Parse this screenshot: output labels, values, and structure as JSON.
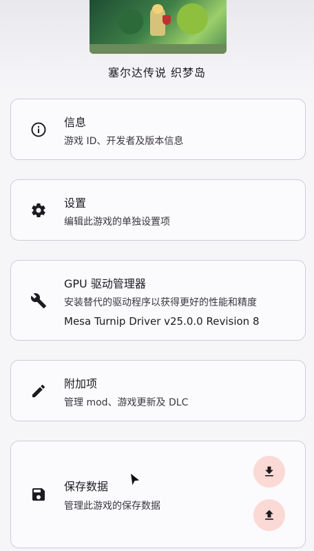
{
  "game": {
    "title": "塞尔达传说 织梦岛"
  },
  "cards": {
    "info": {
      "title": "信息",
      "subtitle": "游戏 ID、开发者及版本信息",
      "icon": "info-icon"
    },
    "settings": {
      "title": "设置",
      "subtitle": "编辑此游戏的单独设置项",
      "icon": "gear-icon"
    },
    "gpu": {
      "title": "GPU 驱动管理器",
      "subtitle": "安装替代的驱动程序以获得更好的性能和精度",
      "driver": "Mesa Turnip Driver v25.0.0 Revision 8",
      "icon": "wrench-icon"
    },
    "addons": {
      "title": "附加项",
      "subtitle": "管理 mod、游戏更新及 DLC",
      "icon": "pencil-icon"
    },
    "saves": {
      "title": "保存数据",
      "subtitle": "管理此游戏的保存数据",
      "icon": "save-icon"
    }
  },
  "colors": {
    "fab_bg": "#fbd9d5",
    "card_border": "#cfcdd3"
  }
}
